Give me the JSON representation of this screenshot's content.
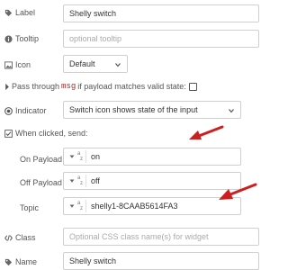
{
  "form": {
    "label": {
      "text": "Label",
      "value": "Shelly switch",
      "icon": "tag-icon"
    },
    "tooltip": {
      "text": "Tooltip",
      "placeholder": "optional tooltip",
      "icon": "info-circle-icon"
    },
    "icon": {
      "text": "Icon",
      "value": "Default",
      "icon": "picture-icon"
    },
    "passthrough": {
      "before": "Pass through",
      "code": "msg",
      "after": "if payload matches valid state:",
      "checked": false,
      "icon": "caret-right-icon"
    },
    "indicator": {
      "text": "Indicator",
      "value": "Switch icon shows state of the input",
      "icon": "toggle-icon"
    },
    "when_clicked": {
      "text": "When clicked, send:",
      "icon": "checkbox-icon"
    },
    "on_payload": {
      "text": "On Payload",
      "type_glyph": "a-z",
      "value": "on"
    },
    "off_payload": {
      "text": "Off Payload",
      "type_glyph": "a-z",
      "value": "off"
    },
    "topic": {
      "text": "Topic",
      "type_glyph": "a-z",
      "value": "shelly1-8CAAB5614FA3"
    },
    "class": {
      "text": "Class",
      "placeholder": "Optional CSS class name(s) for widget",
      "icon": "code-icon"
    },
    "name": {
      "text": "Name",
      "value": "Shelly switch",
      "icon": "tag-icon"
    }
  },
  "colors": {
    "annotation_arrow": "#cc1f1f",
    "code_text": "#b22222"
  }
}
